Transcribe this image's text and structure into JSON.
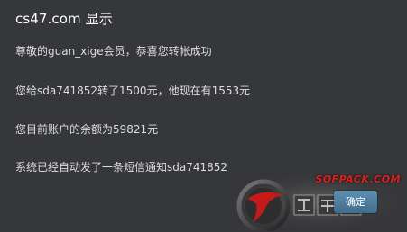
{
  "dialog": {
    "title": "cs47.com 显示",
    "messages": [
      "尊敬的guan_xige会员，恭喜您转帐成功",
      "您给sda741852转了1500元，他现在有1553元",
      "您目前账户的余额为59821元",
      "系统已经自动发了一条短信通知sda741852"
    ],
    "ok_label": "确定"
  },
  "watermark": {
    "brand": "SOFPACK.COM"
  },
  "colors": {
    "background": "#36373b",
    "button": "#4f7fa0",
    "watermark_red": "#e02020"
  }
}
